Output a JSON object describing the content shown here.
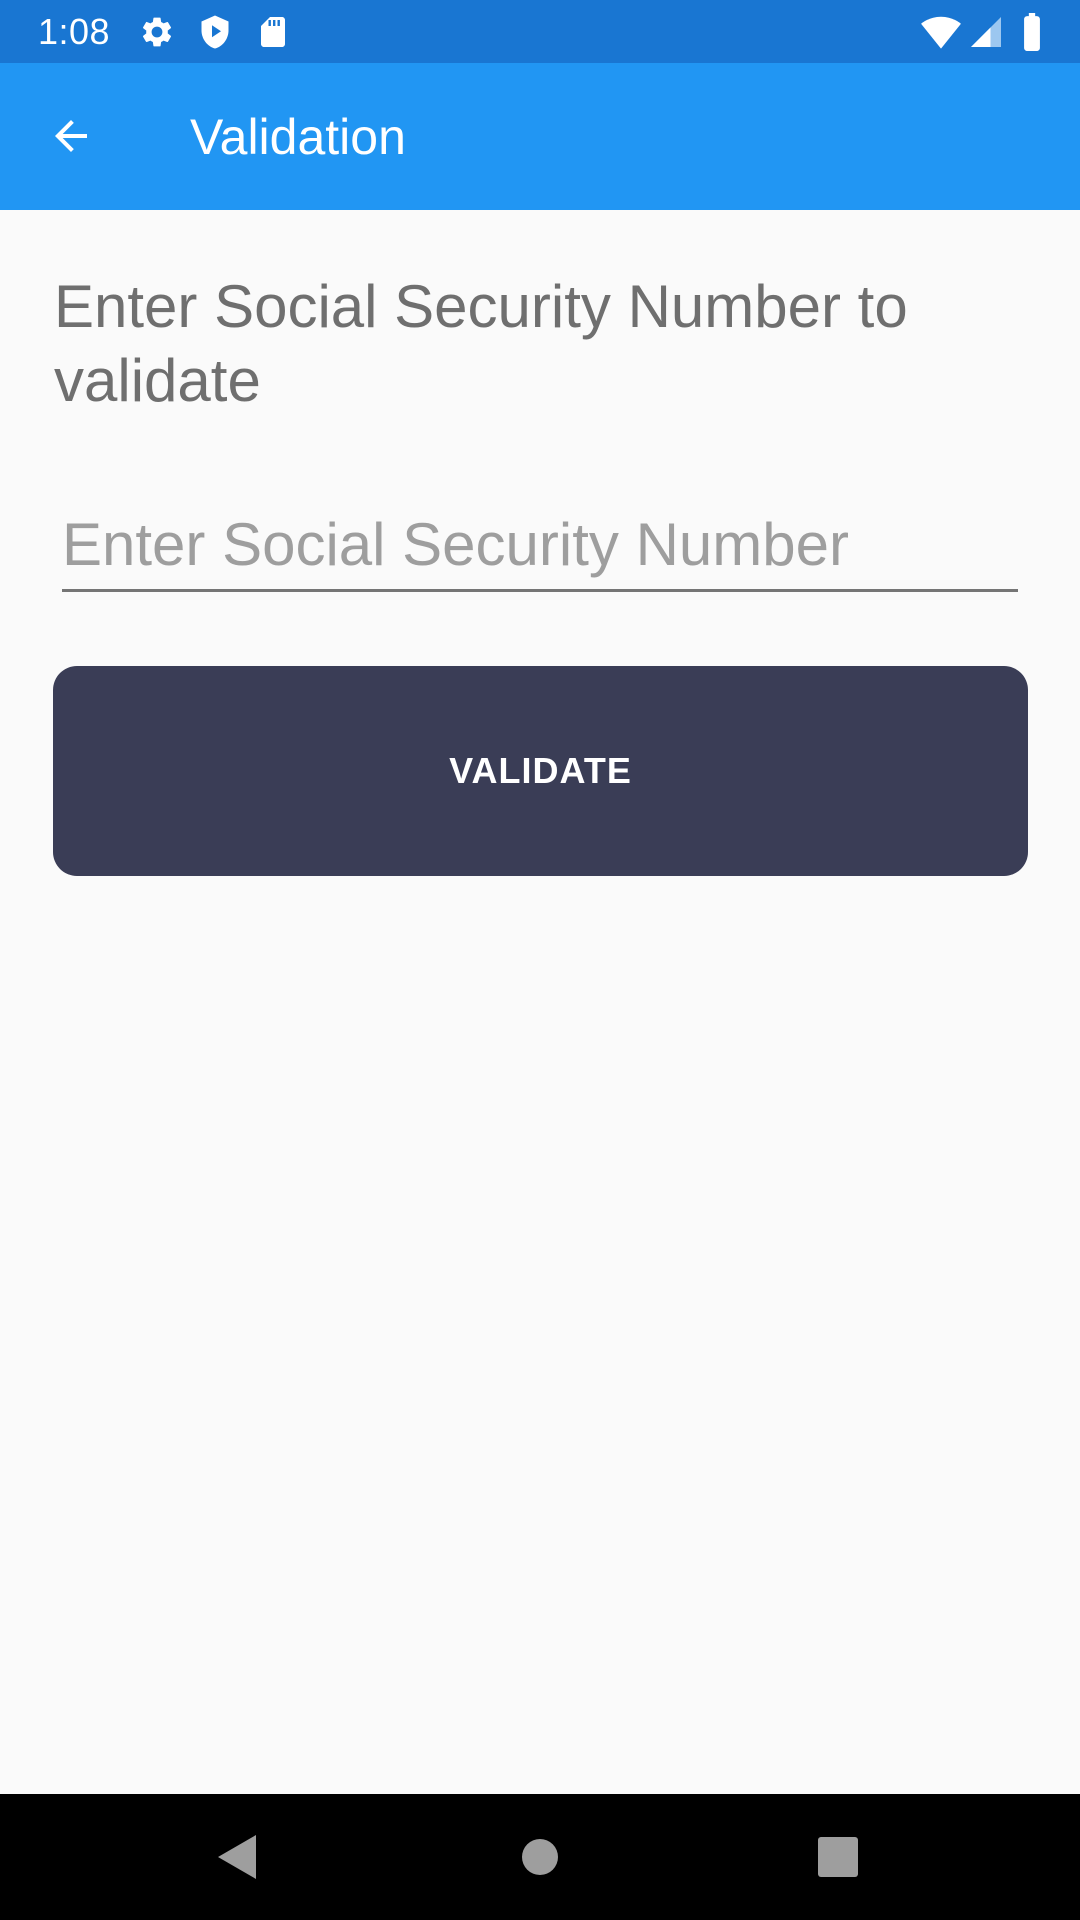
{
  "status_bar": {
    "time": "1:08",
    "icons": [
      "gear-icon",
      "shield-play-icon",
      "sd-card-icon",
      "wifi-icon",
      "signal-icon",
      "battery-icon"
    ]
  },
  "app_bar": {
    "title": "Validation",
    "back_icon": "arrow-back-icon",
    "background_color": "#2196f3",
    "status_color": "#1976d2"
  },
  "main": {
    "prompt": "Enter Social Security Number to validate",
    "ssn_input": {
      "value": "",
      "placeholder": "Enter Social Security Number"
    },
    "validate_button": {
      "label": "VALIDATE",
      "color": "#3a3d56"
    }
  },
  "nav_bar": {
    "buttons": [
      "back-triangle-icon",
      "home-circle-icon",
      "recents-square-icon"
    ]
  }
}
